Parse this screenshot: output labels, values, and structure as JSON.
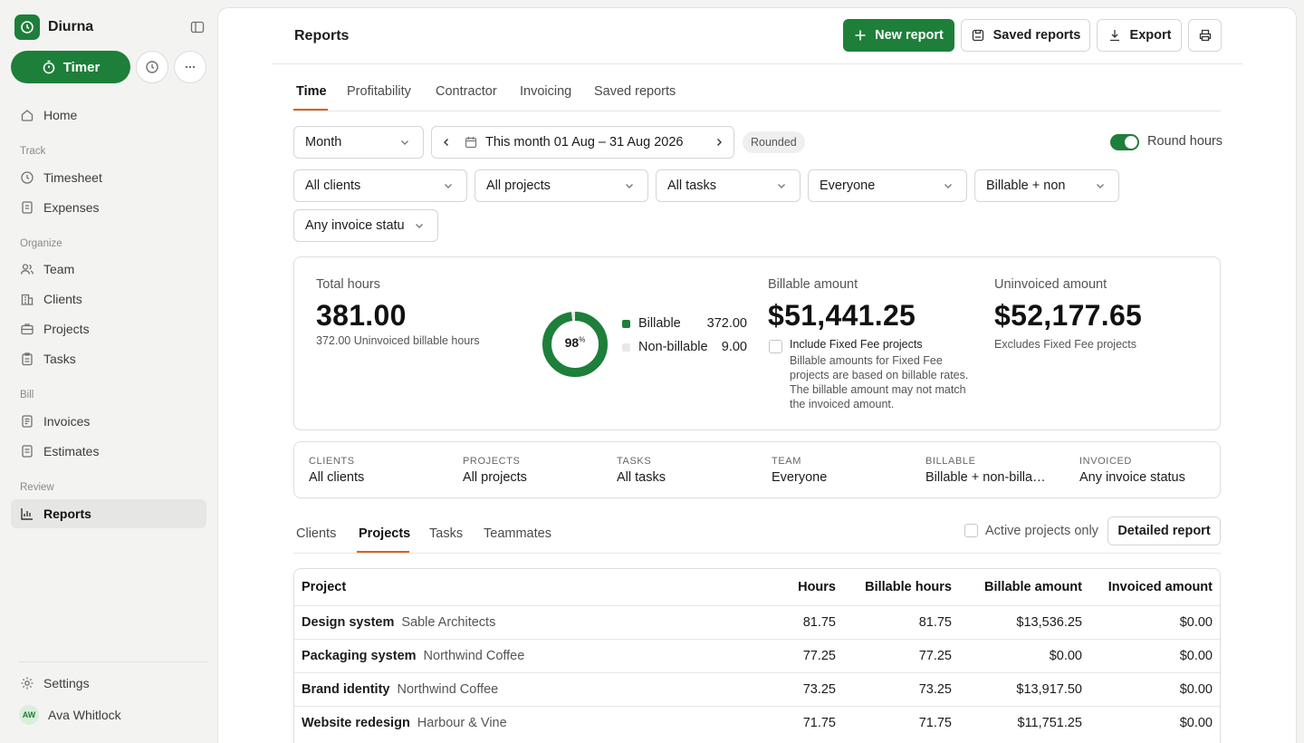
{
  "app": {
    "name": "Diurna"
  },
  "sidebar": {
    "timer_label": "Timer",
    "items": {
      "home": "Home",
      "timesheet": "Timesheet",
      "expenses": "Expenses",
      "team": "Team",
      "clients": "Clients",
      "projects": "Projects",
      "tasks": "Tasks",
      "invoices": "Invoices",
      "estimates": "Estimates",
      "reports": "Reports",
      "settings": "Settings"
    },
    "sections": {
      "track": "Track",
      "organize": "Organize",
      "bill": "Bill",
      "review": "Review"
    },
    "active_item": "reports",
    "user": {
      "initials": "AW",
      "name": "Ava Whitlock"
    }
  },
  "header": {
    "title": "Reports",
    "new_report": "New report",
    "saved_reports": "Saved reports",
    "export": "Export"
  },
  "report_tabs": [
    "Time",
    "Profitability",
    "Contractor",
    "Invoicing",
    "Saved reports"
  ],
  "active_report_tab": "Time",
  "filters": {
    "period": "Month",
    "date_range": "This month 01 Aug – 31 Aug 2026",
    "rounded_badge": "Rounded",
    "round_hours_label": "Round hours",
    "round_hours_on": true,
    "clients": "All clients",
    "projects": "All projects",
    "tasks": "All tasks",
    "team": "Everyone",
    "billable": "Billable + non",
    "invoice_status": "Any invoice statu"
  },
  "summary": {
    "total_hours_label": "Total hours",
    "total_hours": "381.00",
    "uninvoiced_note": "372.00 Uninvoiced billable hours",
    "donut_pct": "98",
    "donut_pct_suffix": "%",
    "donut_fraction": 0.98,
    "legend": [
      {
        "label": "Billable",
        "value": "372.00",
        "color": "#1d7f3a"
      },
      {
        "label": "Non-billable",
        "value": "9.00",
        "color": "#e8e8e8"
      }
    ],
    "billable_amount_label": "Billable amount",
    "billable_amount": "$51,441.25",
    "fixed_fee_checkbox": "Include Fixed Fee projects",
    "fixed_fee_note": "Billable amounts for Fixed Fee projects are based on billable rates. The billable amount may not match the invoiced amount.",
    "uninvoiced_amount_label": "Uninvoiced amount",
    "uninvoiced_amount": "$52,177.65",
    "uninvoiced_amount_note": "Excludes Fixed Fee projects"
  },
  "filter_summary": [
    {
      "label": "CLIENTS",
      "value": "All clients"
    },
    {
      "label": "PROJECTS",
      "value": "All projects"
    },
    {
      "label": "TASKS",
      "value": "All tasks"
    },
    {
      "label": "TEAM",
      "value": "Everyone"
    },
    {
      "label": "BILLABLE",
      "value": "Billable + non-billable"
    },
    {
      "label": "INVOICED",
      "value": "Any invoice status"
    }
  ],
  "breakdown": {
    "tabs": [
      "Clients",
      "Projects",
      "Tasks",
      "Teammates"
    ],
    "active_tab": "Projects",
    "active_only_label": "Active projects only",
    "detailed_report": "Detailed report",
    "columns": [
      "Project",
      "Hours",
      "Billable hours",
      "Billable amount",
      "Invoiced amount"
    ],
    "rows": [
      {
        "project": "Design system",
        "client": "Sable Architects",
        "hours": "81.75",
        "billable_hours": "81.75",
        "billable_amount": "$13,536.25",
        "invoiced_amount": "$0.00"
      },
      {
        "project": "Packaging system",
        "client": "Northwind Coffee",
        "hours": "77.25",
        "billable_hours": "77.25",
        "billable_amount": "$0.00",
        "invoiced_amount": "$0.00"
      },
      {
        "project": "Brand identity",
        "client": "Northwind Coffee",
        "hours": "73.25",
        "billable_hours": "73.25",
        "billable_amount": "$13,917.50",
        "invoiced_amount": "$0.00"
      },
      {
        "project": "Website redesign",
        "client": "Harbour & Vine",
        "hours": "71.75",
        "billable_hours": "71.75",
        "billable_amount": "$11,751.25",
        "invoiced_amount": "$0.00"
      }
    ]
  }
}
